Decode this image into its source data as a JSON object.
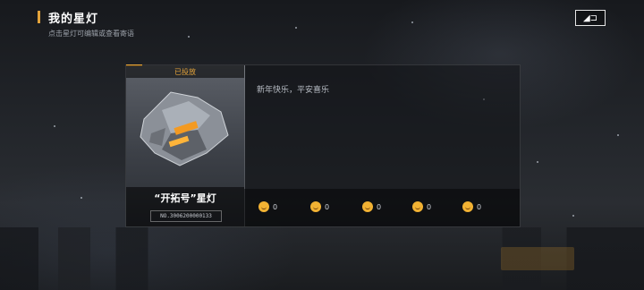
{
  "header": {
    "title": "我的星灯",
    "subtitle": "点击星灯可编辑或查看寄语"
  },
  "back_button": {
    "icon": "back-icon",
    "label": "◢⊐"
  },
  "card": {
    "status": "已投放",
    "name": "“开拓号”星灯",
    "id": "NO.3006200000133",
    "image": "spaceship-illustration"
  },
  "message": "新年快乐，平安喜乐",
  "reactions": [
    {
      "icon": "thumbs-up-emoji",
      "count": "0"
    },
    {
      "icon": "party-emoji",
      "count": "0"
    },
    {
      "icon": "dizzy-emoji",
      "count": "0"
    },
    {
      "icon": "laughing-emoji",
      "count": "0"
    },
    {
      "icon": "cat-emoji",
      "count": "0"
    }
  ],
  "colors": {
    "accent": "#e2a23a",
    "text": "#ffffff",
    "muted": "#9aa0a8"
  }
}
